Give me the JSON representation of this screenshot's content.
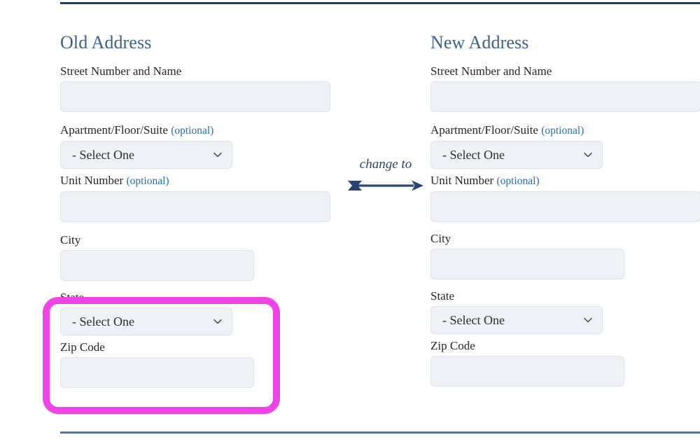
{
  "page": {
    "top_rule_color": "#1c3a6e",
    "bottom_rule_color": "#5b7196",
    "background": "#ffffff"
  },
  "colors": {
    "heading": "#3f5f8c",
    "label": "#252628",
    "optional": "#2c6cb4",
    "field_fill": "#eef2f7",
    "field_border": "#dde4ee",
    "highlight": "#ee44e8",
    "arrow": "#2c4372"
  },
  "old_address": {
    "heading": "Old Address",
    "fields": {
      "street_label": "Street Number and Name",
      "apartment_label": "Apartment/Floor/Suite",
      "apartment_optional": "(optional)",
      "apartment_value": "- Select One",
      "unit_label": "Unit Number",
      "unit_optional": "(optional)",
      "city_label": "City",
      "state_label": "State",
      "state_value": "- Select One",
      "zip_label": "Zip Code"
    },
    "values": {
      "street": "",
      "unit": "",
      "city": "",
      "zip": ""
    }
  },
  "new_address": {
    "heading": "New Address",
    "fields": {
      "street_label": "Street Number and Name",
      "apartment_label": "Apartment/Floor/Suite",
      "apartment_optional": "(optional)",
      "apartment_value": "- Select One",
      "unit_label": "Unit Number",
      "unit_optional": "(optional)",
      "city_label": "City",
      "state_label": "State",
      "state_value": "- Select One",
      "zip_label": "Zip Code"
    },
    "values": {
      "street": "",
      "unit": "",
      "city": "",
      "zip": ""
    }
  },
  "connector": {
    "label": "change to",
    "icon": "right-arrow-icon"
  },
  "highlight": {
    "target": "old-address-state-and-zip",
    "color": "#ee44e8"
  },
  "icons": {
    "chevron": "chevron-down-icon",
    "arrow": "arrow-right-icon"
  }
}
